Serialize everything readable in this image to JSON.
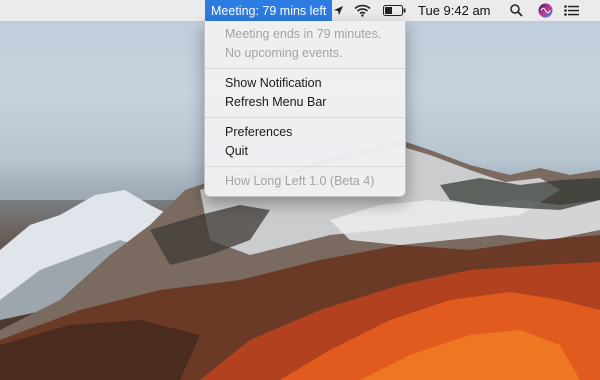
{
  "menubar": {
    "status_item": "Meeting: 79 mins left",
    "clock": "Tue 9:42 am",
    "icons": [
      "location-arrow-icon",
      "wifi-icon",
      "battery-icon",
      "search-icon",
      "siri-icon",
      "notification-center-icon"
    ]
  },
  "menu": {
    "info_line1": "Meeting ends in 79 minutes.",
    "info_line2": "No upcoming events.",
    "show_notification": "Show Notification",
    "refresh_menu_bar": "Refresh Menu Bar",
    "preferences": "Preferences",
    "quit": "Quit",
    "version": "How Long Left 1.0 (Beta 4)"
  },
  "colors": {
    "highlight": "#2d7ce3"
  }
}
